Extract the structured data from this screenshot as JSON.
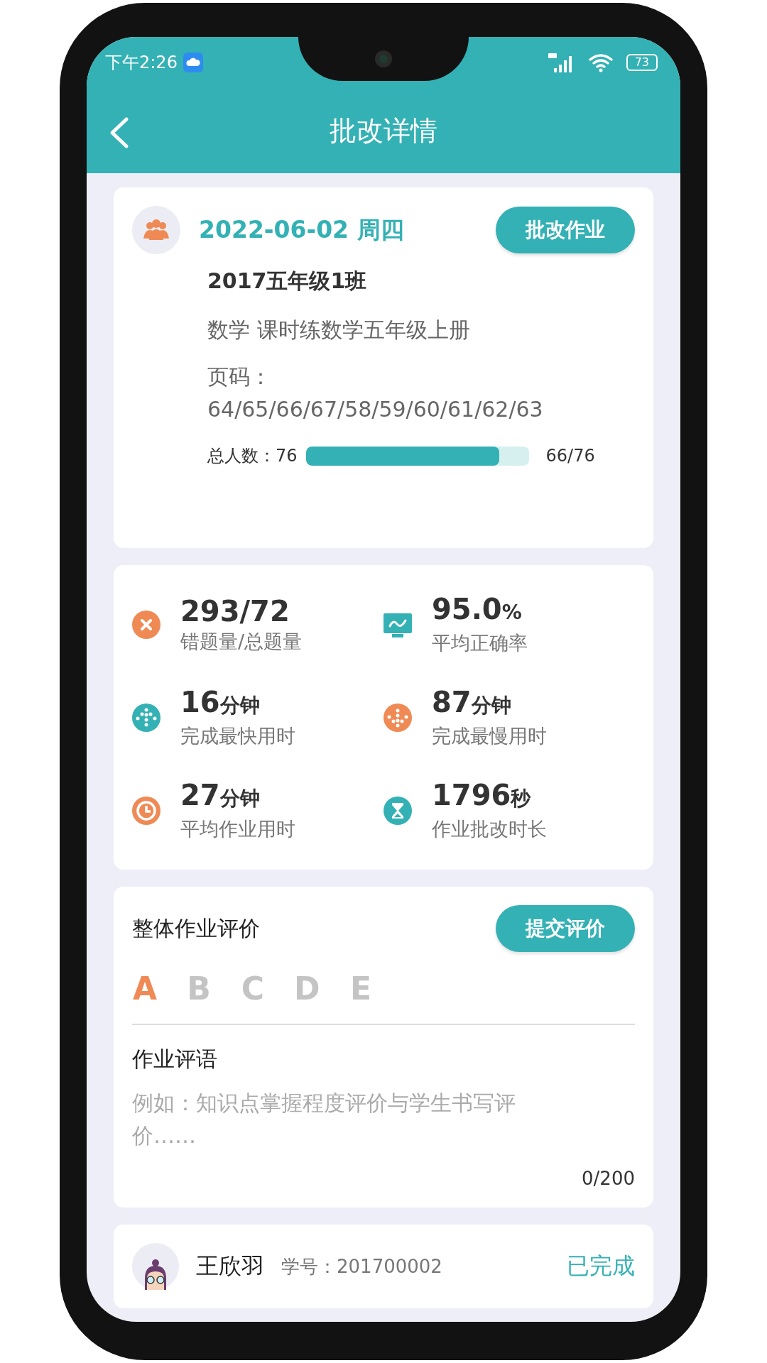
{
  "status_bar": {
    "time": "下午2:26",
    "battery": "73"
  },
  "nav": {
    "title": "批改详情"
  },
  "assignment": {
    "date": "2022-06-02 周四",
    "action": "批改作业",
    "class_name": "2017五年级1班",
    "subject": "数学 课时练数学五年级上册",
    "pages": "页码：64/65/66/67/58/59/60/61/62/63",
    "total_label": "总人数：76",
    "progress": {
      "level": 0.868,
      "count": "66/76"
    }
  },
  "stats": [
    {
      "kind": "error",
      "color": "#ef8a55",
      "value": "293/72",
      "label": "错题量/总题量"
    },
    {
      "kind": "monitor",
      "color": "#34b1b4",
      "value": "95.0",
      "unit": "%",
      "label": "平均正确率"
    },
    {
      "kind": "up",
      "color": "#34b1b4",
      "value": "16",
      "unit": "分钟",
      "label": "完成最快用时"
    },
    {
      "kind": "down",
      "color": "#ef8a55",
      "value": "87",
      "unit": "分钟",
      "label": "完成最慢用时"
    },
    {
      "kind": "clock",
      "color": "#ef8a55",
      "value": "27",
      "unit": "分钟",
      "label": "平均作业用时"
    },
    {
      "kind": "hourglass",
      "color": "#34b1b4",
      "value": "1796",
      "unit": "秒",
      "label": "作业批改时长"
    }
  ],
  "evaluation": {
    "title": "整体作业评价",
    "action": "提交评价",
    "grades": [
      {
        "label": "A",
        "selected": true
      },
      {
        "label": "B",
        "selected": false
      },
      {
        "label": "C",
        "selected": false
      },
      {
        "label": "D",
        "selected": false
      },
      {
        "label": "E",
        "selected": false
      }
    ],
    "comment_title": "作业评语",
    "placeholder": "例如：知识点掌握程度评价与学生书写评价……",
    "count": "0/200"
  },
  "students": [
    {
      "name": "王欣羽",
      "number": "学号：201700002",
      "status": "已完成"
    }
  ]
}
